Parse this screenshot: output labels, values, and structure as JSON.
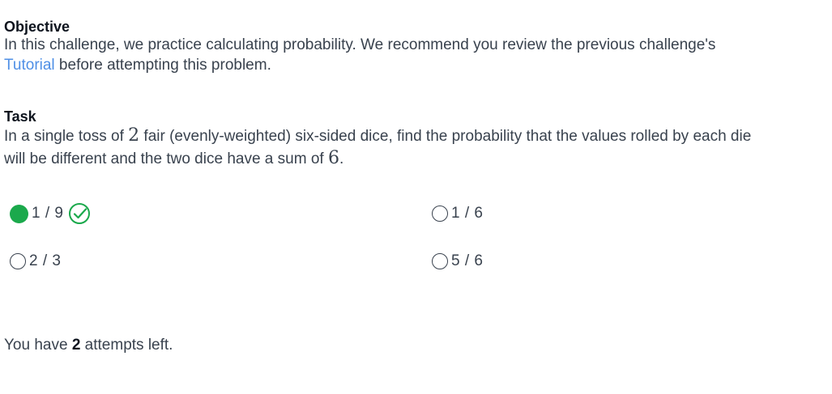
{
  "objective": {
    "title": "Objective",
    "line1": "In this challenge, we practice calculating probability. We recommend you review the previous challenge's",
    "link_text": "Tutorial",
    "line2_rest": " before attempting this problem."
  },
  "task": {
    "title": "Task",
    "line1_a": "In a single toss of ",
    "num_dice": "2",
    "line1_b": " fair (evenly-weighted) six-sided dice, find the probability that the values rolled by each die",
    "line2_a": "will be different and the two dice have a sum of ",
    "sum_value": "6",
    "line2_b": "."
  },
  "options": [
    {
      "label": "1 / 9",
      "selected": true,
      "correct": true
    },
    {
      "label": "1 / 6",
      "selected": false
    },
    {
      "label": "2 / 3",
      "selected": false
    },
    {
      "label": "5 / 6",
      "selected": false
    }
  ],
  "attempts": {
    "prefix": "You have ",
    "count": "2",
    "suffix": " attempts left."
  },
  "colors": {
    "selected": "#1ba94c",
    "link": "#4f8fe6",
    "text": "#39424e"
  },
  "icons": {
    "correct": "check-circle-icon"
  }
}
